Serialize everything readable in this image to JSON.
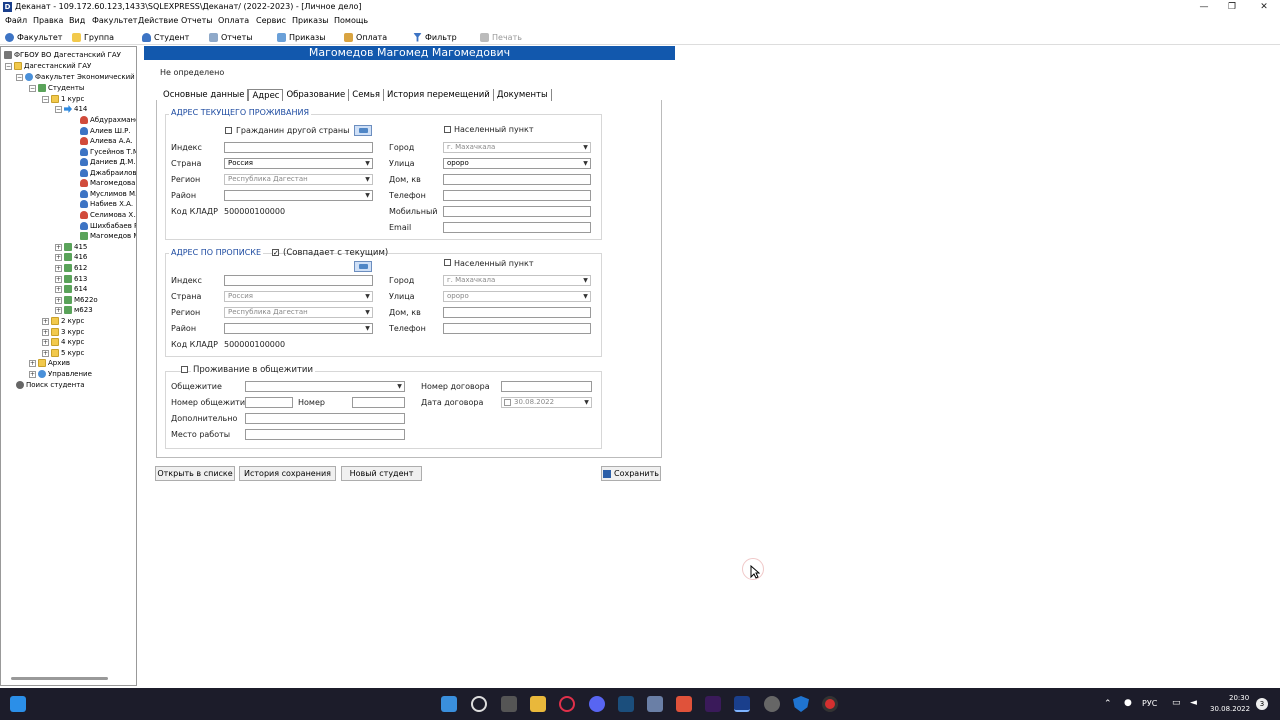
{
  "window": {
    "title": "Деканат - 109.172.60.123,1433\\SQLEXPRESS\\Деканат/ (2022-2023) - [Личное дело]",
    "app_icon": "D"
  },
  "menu": [
    "Файл",
    "Правка",
    "Вид",
    "Факультет",
    "Действие",
    "Отчеты",
    "Оплата",
    "Сервис",
    "Приказы",
    "Помощь"
  ],
  "toolbar": {
    "faculty": "Факультет",
    "group": "Группа",
    "student": "Студент",
    "reports": "Отчеты",
    "orders": "Приказы",
    "payment": "Оплата",
    "filter": "Фильтр",
    "print": "Печать"
  },
  "tree": {
    "root": "ФГБОУ ВО Дагестанский ГАУ",
    "university": "Дагестанский ГАУ",
    "faculty": "Факультет Экономический",
    "students": "Студенты",
    "course1": "1 курс",
    "group414": "414",
    "students414": [
      "Абдурахмано",
      "Алиев Ш.Р.",
      "Алиева А.А.",
      "Гусейнов Т.М",
      "Даниев Д.М.",
      "Джабраилов",
      "Магомедова Т",
      "Муслимов М.Е",
      "Набиев Х.А.",
      "Селимова Х.Х",
      "Шихбабаев Р.",
      "Магомедов М"
    ],
    "groups": [
      "415",
      "416",
      "612",
      "613",
      "614",
      "М622о",
      "м623"
    ],
    "courses": [
      "2 курс",
      "3 курс",
      "4 курс",
      "5 курс"
    ],
    "archive": "Архив",
    "management": "Управление",
    "search": "Поиск студента"
  },
  "header": {
    "name": "Магомедов Магомед Магомедович"
  },
  "status": "Не определено",
  "tabs": [
    "Основные данные",
    "Адрес",
    "Образование",
    "Семья",
    "История перемещений",
    "Документы"
  ],
  "current_address": {
    "title": "АДРЕС ТЕКУЩЕГО ПРОЖИВАНИЯ",
    "foreign_label": "Гражданин другой страны",
    "locality_label": "Населенный пункт",
    "index_label": "Индекс",
    "index": "",
    "country_label": "Страна",
    "country": "Россия",
    "region_label": "Регион",
    "region": "Республика Дагестан",
    "district_label": "Район",
    "district": "",
    "kladr_label": "Код КЛАДР",
    "kladr": "500000100000",
    "city_label": "Город",
    "city": "г. Махачкала",
    "street_label": "Улица",
    "street": "ороро",
    "house_label": "Дом, кв",
    "house": "",
    "phone_label": "Телефон",
    "phone": "",
    "mobile_label": "Мобильный",
    "mobile": "",
    "email_label": "Email",
    "email": ""
  },
  "reg_address": {
    "title": "АДРЕС ПО ПРОПИСКЕ",
    "same_label": "(Совпадает с текущим)",
    "locality_label": "Населенный пункт",
    "index_label": "Индекс",
    "index": "",
    "country_label": "Страна",
    "country": "Россия",
    "region_label": "Регион",
    "region": "Республика Дагестан",
    "district_label": "Район",
    "district": "",
    "kladr_label": "Код КЛАДР",
    "kladr": "500000100000",
    "city_label": "Город",
    "city": "г. Махачкала",
    "street_label": "Улица",
    "street": "ороро",
    "house_label": "Дом, кв",
    "house": "",
    "phone_label": "Телефон",
    "phone": ""
  },
  "dorm": {
    "title": "Проживание в общежитии",
    "dorm_label": "Общежитие",
    "dorm_number_label": "Номер общежития",
    "room_label": "Номер",
    "additional_label": "Дополнительно",
    "work_label": "Место работы",
    "contract_number_label": "Номер договора",
    "contract_date_label": "Дата договора",
    "contract_date": "30.08.2022"
  },
  "buttons": {
    "open_in_list": "Открыть в списке",
    "save_history": "История сохранения",
    "new_student": "Новый студент",
    "save": "Сохранить"
  },
  "tray": {
    "lang": "РУС",
    "time": "20:30",
    "date": "30.08.2022",
    "notif": "3"
  }
}
